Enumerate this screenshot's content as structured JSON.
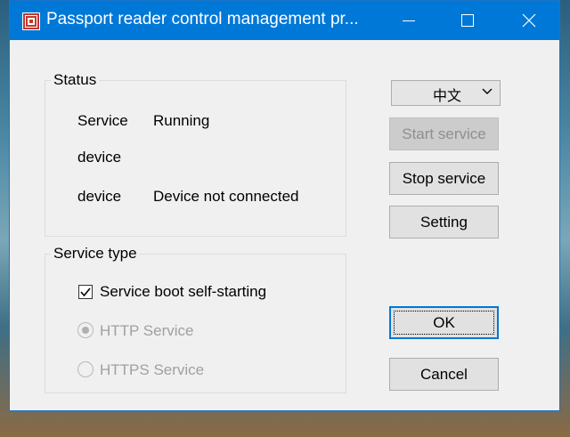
{
  "window": {
    "title": "Passport reader control management pr...",
    "icon": "app-logo-icon"
  },
  "status": {
    "group_label": "Status",
    "rows": [
      {
        "label": "Service",
        "value": "Running"
      },
      {
        "label": "device",
        "value": ""
      },
      {
        "label": "device",
        "value": "Device not connected"
      }
    ]
  },
  "service_type": {
    "group_label": "Service type",
    "boot_label": "Service boot self-starting",
    "boot_checked": true,
    "http_label": "HTTP Service",
    "http_selected": true,
    "https_label": "HTTPS Service",
    "https_selected": false
  },
  "language": {
    "value": "中文"
  },
  "buttons": {
    "start": "Start service",
    "stop": "Stop service",
    "setting": "Setting",
    "ok": "OK",
    "cancel": "Cancel"
  },
  "colors": {
    "titlebar": "#0078d7",
    "window_bg": "#f0f0f0"
  }
}
